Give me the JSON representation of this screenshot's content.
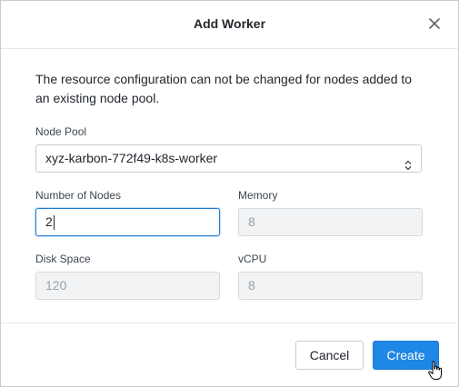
{
  "dialog": {
    "title": "Add Worker",
    "description": "The resource configuration can not be changed for nodes added to an existing node pool."
  },
  "form": {
    "node_pool": {
      "label": "Node Pool",
      "value": "xyz-karbon-772f49-k8s-worker"
    },
    "number_of_nodes": {
      "label": "Number of Nodes",
      "value": "2"
    },
    "memory": {
      "label": "Memory",
      "value": "8"
    },
    "disk_space": {
      "label": "Disk Space",
      "value": "120"
    },
    "vcpu": {
      "label": "vCPU",
      "value": "8"
    }
  },
  "footer": {
    "cancel_label": "Cancel",
    "create_label": "Create"
  },
  "icons": {
    "close": "close-icon",
    "select_arrows": "select-arrows-icon",
    "cursor": "hand-pointer-cursor"
  },
  "colors": {
    "primary": "#1f87e5",
    "focus_border": "#1f7fd6",
    "disabled_bg": "#f2f3f4"
  }
}
